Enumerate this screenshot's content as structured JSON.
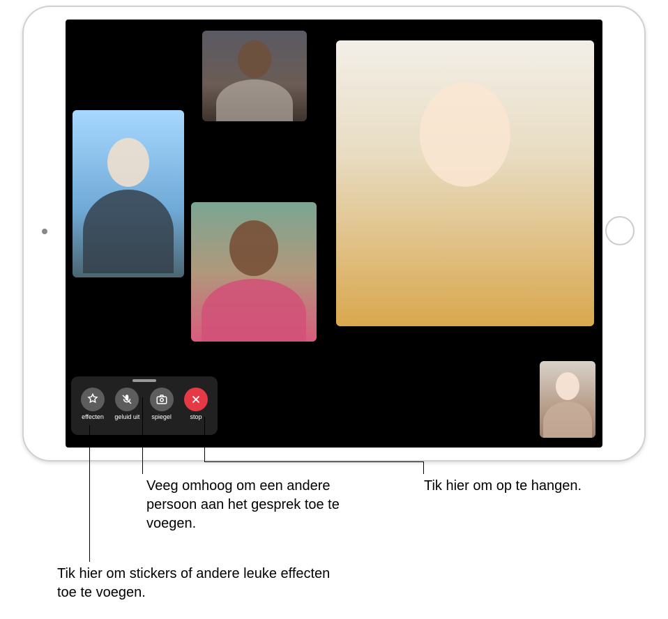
{
  "device": "iPad",
  "app": "FaceTime",
  "screen": {
    "tiles": {
      "main": "participant-large",
      "p1": "participant-left",
      "p2": "participant-top-small",
      "p3": "participant-center",
      "self": "self-preview"
    }
  },
  "controls": {
    "effects": {
      "label": "effecten",
      "name": "effects-button"
    },
    "mute": {
      "label": "geluid uit",
      "name": "mute-button"
    },
    "flip": {
      "label": "spiegel",
      "name": "flip-camera-button"
    },
    "end": {
      "label": "stop",
      "name": "end-call-button"
    }
  },
  "callouts": {
    "swipe_up": "Veeg omhoog om een andere persoon aan het gesprek toe te voegen.",
    "hang_up": "Tik hier om op te hangen.",
    "effects": "Tik hier om stickers of andere leuke effecten toe te voegen."
  }
}
